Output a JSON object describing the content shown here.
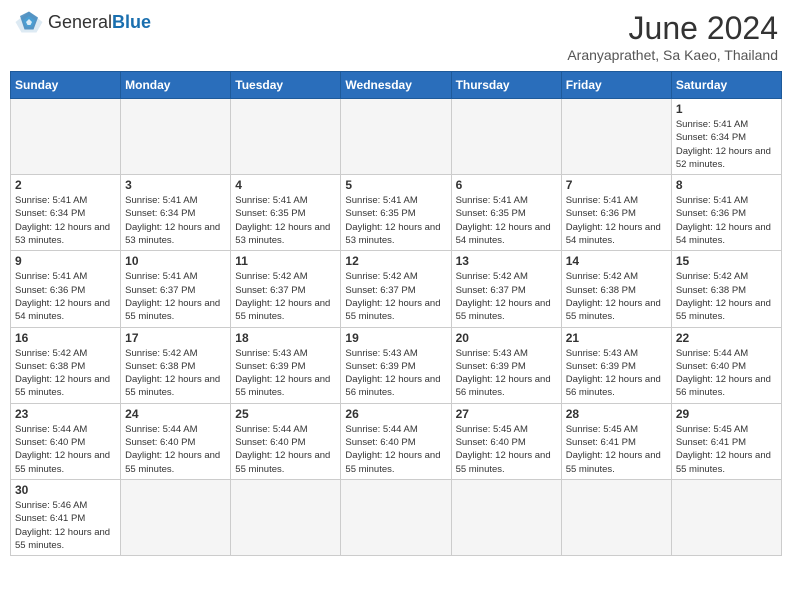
{
  "logo": {
    "text_general": "General",
    "text_blue": "Blue"
  },
  "title": "June 2024",
  "location": "Aranyaprathet, Sa Kaeo, Thailand",
  "days_of_week": [
    "Sunday",
    "Monday",
    "Tuesday",
    "Wednesday",
    "Thursday",
    "Friday",
    "Saturday"
  ],
  "weeks": [
    [
      {
        "day": null,
        "info": null
      },
      {
        "day": null,
        "info": null
      },
      {
        "day": null,
        "info": null
      },
      {
        "day": null,
        "info": null
      },
      {
        "day": null,
        "info": null
      },
      {
        "day": null,
        "info": null
      },
      {
        "day": "1",
        "info": "Sunrise: 5:41 AM\nSunset: 6:34 PM\nDaylight: 12 hours and 52 minutes."
      }
    ],
    [
      {
        "day": "2",
        "info": "Sunrise: 5:41 AM\nSunset: 6:34 PM\nDaylight: 12 hours and 53 minutes."
      },
      {
        "day": "3",
        "info": "Sunrise: 5:41 AM\nSunset: 6:34 PM\nDaylight: 12 hours and 53 minutes."
      },
      {
        "day": "4",
        "info": "Sunrise: 5:41 AM\nSunset: 6:35 PM\nDaylight: 12 hours and 53 minutes."
      },
      {
        "day": "5",
        "info": "Sunrise: 5:41 AM\nSunset: 6:35 PM\nDaylight: 12 hours and 53 minutes."
      },
      {
        "day": "6",
        "info": "Sunrise: 5:41 AM\nSunset: 6:35 PM\nDaylight: 12 hours and 54 minutes."
      },
      {
        "day": "7",
        "info": "Sunrise: 5:41 AM\nSunset: 6:36 PM\nDaylight: 12 hours and 54 minutes."
      },
      {
        "day": "8",
        "info": "Sunrise: 5:41 AM\nSunset: 6:36 PM\nDaylight: 12 hours and 54 minutes."
      }
    ],
    [
      {
        "day": "9",
        "info": "Sunrise: 5:41 AM\nSunset: 6:36 PM\nDaylight: 12 hours and 54 minutes."
      },
      {
        "day": "10",
        "info": "Sunrise: 5:41 AM\nSunset: 6:37 PM\nDaylight: 12 hours and 55 minutes."
      },
      {
        "day": "11",
        "info": "Sunrise: 5:42 AM\nSunset: 6:37 PM\nDaylight: 12 hours and 55 minutes."
      },
      {
        "day": "12",
        "info": "Sunrise: 5:42 AM\nSunset: 6:37 PM\nDaylight: 12 hours and 55 minutes."
      },
      {
        "day": "13",
        "info": "Sunrise: 5:42 AM\nSunset: 6:37 PM\nDaylight: 12 hours and 55 minutes."
      },
      {
        "day": "14",
        "info": "Sunrise: 5:42 AM\nSunset: 6:38 PM\nDaylight: 12 hours and 55 minutes."
      },
      {
        "day": "15",
        "info": "Sunrise: 5:42 AM\nSunset: 6:38 PM\nDaylight: 12 hours and 55 minutes."
      }
    ],
    [
      {
        "day": "16",
        "info": "Sunrise: 5:42 AM\nSunset: 6:38 PM\nDaylight: 12 hours and 55 minutes."
      },
      {
        "day": "17",
        "info": "Sunrise: 5:42 AM\nSunset: 6:38 PM\nDaylight: 12 hours and 55 minutes."
      },
      {
        "day": "18",
        "info": "Sunrise: 5:43 AM\nSunset: 6:39 PM\nDaylight: 12 hours and 55 minutes."
      },
      {
        "day": "19",
        "info": "Sunrise: 5:43 AM\nSunset: 6:39 PM\nDaylight: 12 hours and 56 minutes."
      },
      {
        "day": "20",
        "info": "Sunrise: 5:43 AM\nSunset: 6:39 PM\nDaylight: 12 hours and 56 minutes."
      },
      {
        "day": "21",
        "info": "Sunrise: 5:43 AM\nSunset: 6:39 PM\nDaylight: 12 hours and 56 minutes."
      },
      {
        "day": "22",
        "info": "Sunrise: 5:44 AM\nSunset: 6:40 PM\nDaylight: 12 hours and 56 minutes."
      }
    ],
    [
      {
        "day": "23",
        "info": "Sunrise: 5:44 AM\nSunset: 6:40 PM\nDaylight: 12 hours and 55 minutes."
      },
      {
        "day": "24",
        "info": "Sunrise: 5:44 AM\nSunset: 6:40 PM\nDaylight: 12 hours and 55 minutes."
      },
      {
        "day": "25",
        "info": "Sunrise: 5:44 AM\nSunset: 6:40 PM\nDaylight: 12 hours and 55 minutes."
      },
      {
        "day": "26",
        "info": "Sunrise: 5:44 AM\nSunset: 6:40 PM\nDaylight: 12 hours and 55 minutes."
      },
      {
        "day": "27",
        "info": "Sunrise: 5:45 AM\nSunset: 6:40 PM\nDaylight: 12 hours and 55 minutes."
      },
      {
        "day": "28",
        "info": "Sunrise: 5:45 AM\nSunset: 6:41 PM\nDaylight: 12 hours and 55 minutes."
      },
      {
        "day": "29",
        "info": "Sunrise: 5:45 AM\nSunset: 6:41 PM\nDaylight: 12 hours and 55 minutes."
      }
    ],
    [
      {
        "day": "30",
        "info": "Sunrise: 5:46 AM\nSunset: 6:41 PM\nDaylight: 12 hours and 55 minutes."
      },
      {
        "day": null,
        "info": null
      },
      {
        "day": null,
        "info": null
      },
      {
        "day": null,
        "info": null
      },
      {
        "day": null,
        "info": null
      },
      {
        "day": null,
        "info": null
      },
      {
        "day": null,
        "info": null
      }
    ]
  ],
  "colors": {
    "header_bg": "#2a6ebb",
    "header_text": "#ffffff",
    "border": "#cccccc",
    "empty_bg": "#f5f5f5"
  }
}
